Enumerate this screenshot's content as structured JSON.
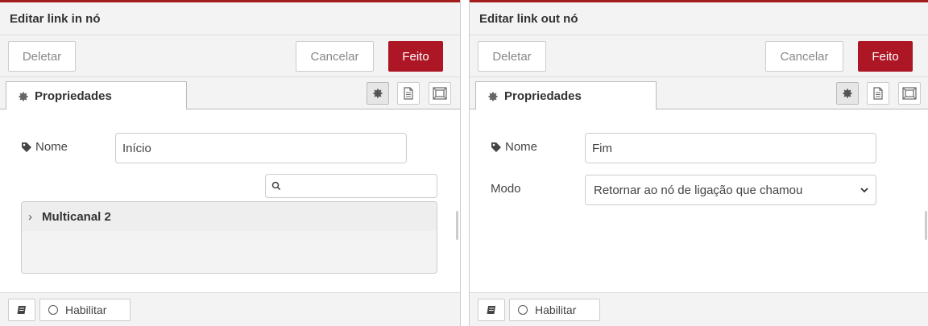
{
  "left": {
    "title": "Editar link in nó",
    "delete_label": "Deletar",
    "cancel_label": "Cancelar",
    "done_label": "Feito",
    "tab_label": "Propriedades",
    "name_label": "Nome",
    "name_value": "Início",
    "tree_item": "Multicanal 2",
    "enable_label": "Habilitar"
  },
  "right": {
    "title": "Editar link out nó",
    "delete_label": "Deletar",
    "cancel_label": "Cancelar",
    "done_label": "Feito",
    "tab_label": "Propriedades",
    "name_label": "Nome",
    "name_value": "Fim",
    "mode_label": "Modo",
    "mode_value": "Retornar ao nó de ligação que chamou",
    "enable_label": "Habilitar"
  },
  "icons": {
    "gear": "gear-icon",
    "description": "file-text-icon",
    "appearance": "frame-icon",
    "tag": "tag-icon",
    "search": "search-icon",
    "book": "book-icon",
    "chevron": "chevron-right-icon",
    "select_arrow": "chevron-down-icon"
  },
  "colors": {
    "accent": "#ad1625",
    "header_bg": "#f3f3f3"
  }
}
